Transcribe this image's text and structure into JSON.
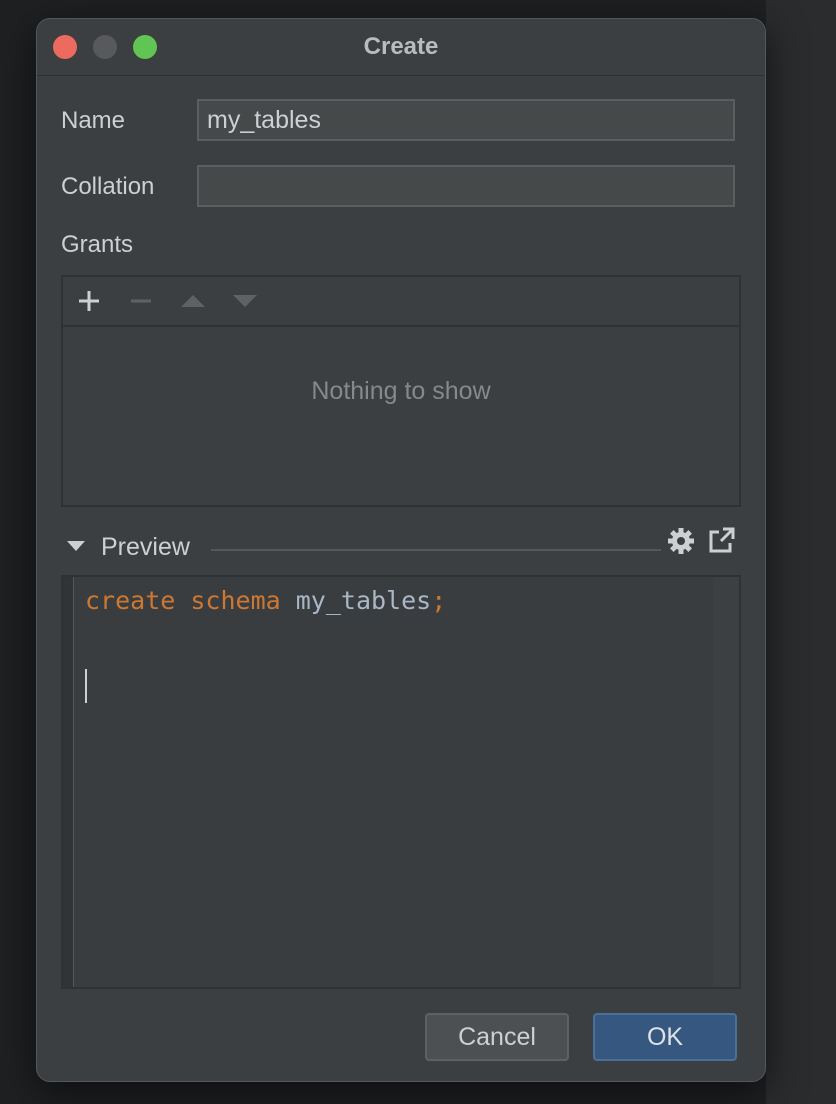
{
  "window": {
    "title": "Create"
  },
  "form": {
    "name_label": "Name",
    "name_value": "my_tables",
    "collation_label": "Collation",
    "collation_value": "",
    "grants_label": "Grants"
  },
  "grants": {
    "toolbar_icons": [
      "add-icon",
      "remove-icon",
      "move-up-icon",
      "move-down-icon"
    ],
    "empty_text": "Nothing to show"
  },
  "preview": {
    "label": "Preview",
    "icons": [
      "gear-icon",
      "open-external-icon"
    ],
    "code": {
      "kw1": "create",
      "kw2": "schema",
      "ident": "my_tables",
      "terminator": ";"
    }
  },
  "buttons": {
    "cancel": "Cancel",
    "ok": "OK"
  },
  "colors": {
    "window_bg": "#3c3f41",
    "keyword": "#cc7832",
    "identifier": "#a9b7c6",
    "ok_button": "#365880",
    "close": "#ed6a5e",
    "maximize": "#61c554"
  }
}
